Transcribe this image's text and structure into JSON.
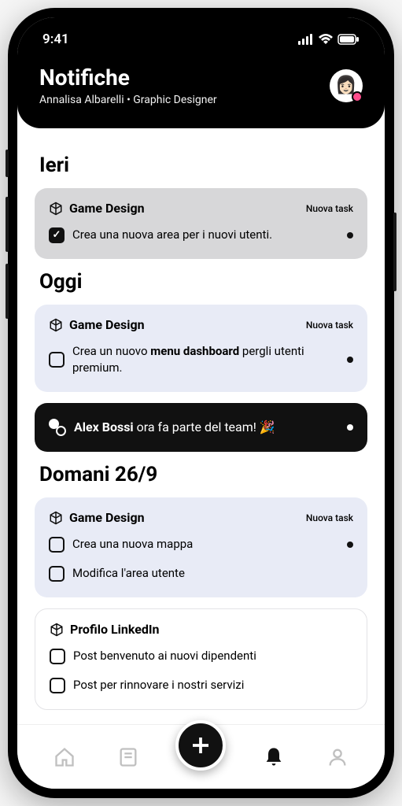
{
  "status": {
    "time": "9:41"
  },
  "header": {
    "title": "Notifiche",
    "subtitle": "Annalisa Albarelli • Graphic Designer"
  },
  "sections": {
    "ieri": {
      "title": "Ieri",
      "card_title": "Game Design",
      "card_tag": "Nuova task",
      "task": "Crea una nuova area per i nuovi utenti."
    },
    "oggi": {
      "title": "Oggi",
      "card_title": "Game Design",
      "card_tag": "Nuova task",
      "task_pre": "Crea un nuovo ",
      "task_bold": "menu dashboard",
      "task_post": " pergli utenti premium.",
      "team_pre": "Alex Bossi",
      "team_post": " ora fa parte del team! 🎉"
    },
    "domani": {
      "title": "Domani 26/9",
      "card1_title": "Game Design",
      "card1_tag": "Nuova task",
      "card1_task1": "Crea una nuova mappa",
      "card1_task2": "Modifica l'area utente",
      "card2_title": "Profilo LinkedIn",
      "card2_task1": "Post benvenuto ai nuovi dipendenti",
      "card2_task2": "Post per rinnovare i nostri servizi"
    }
  }
}
